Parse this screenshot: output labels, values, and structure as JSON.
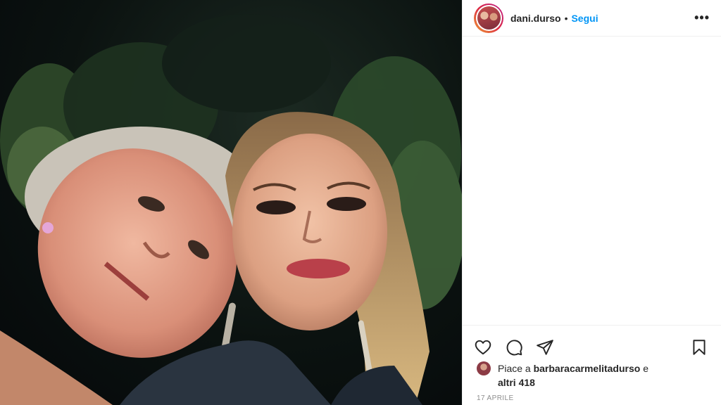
{
  "post": {
    "username": "dani.durso",
    "separator": "•",
    "follow_label": "Segui",
    "more_label": "•••",
    "likes_prefix": "Piace a",
    "likes_user": "barbaracarmelitadurso",
    "likes_joiner": "e",
    "likes_others": "altri 418",
    "date": "17 APRILE"
  },
  "icons": {
    "like": "heart-icon",
    "comment": "comment-icon",
    "share": "share-icon",
    "save": "bookmark-icon",
    "options": "more-icon"
  },
  "colors": {
    "follow": "#0095f6",
    "text": "#262626",
    "muted": "#8e8e8e",
    "divider": "#efefef"
  }
}
